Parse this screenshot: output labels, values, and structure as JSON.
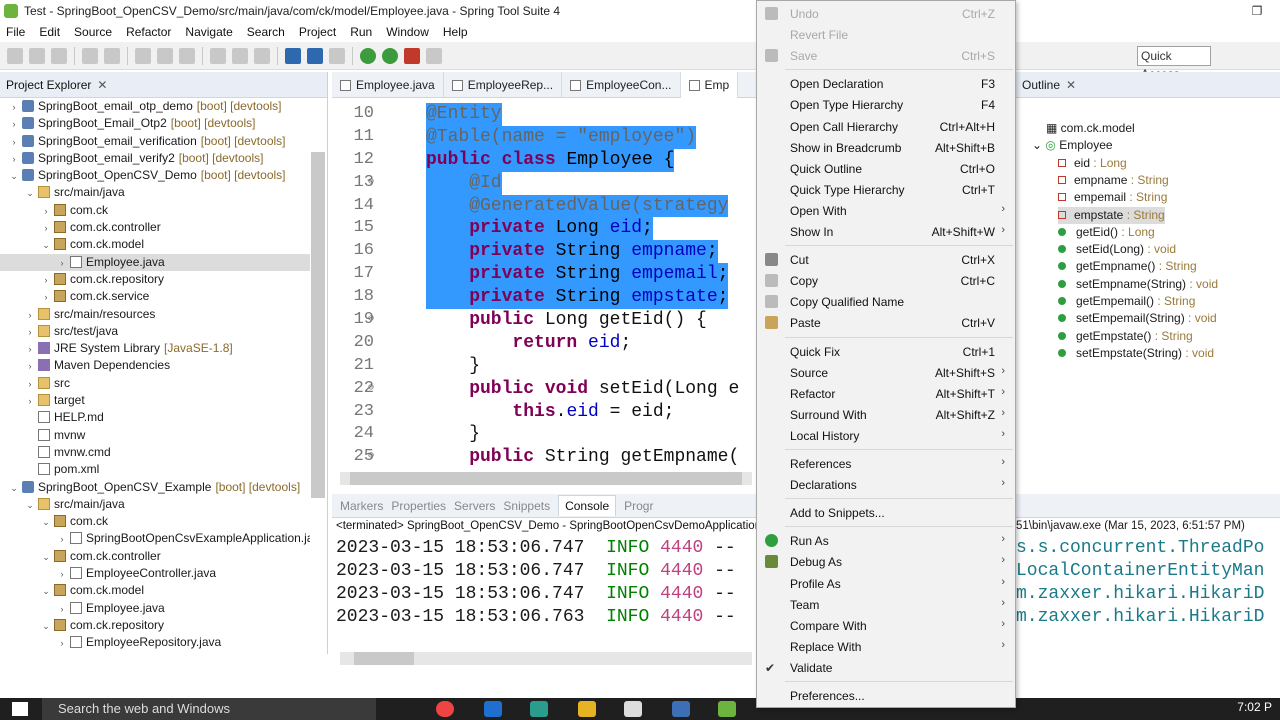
{
  "window": {
    "title": "Test - SpringBoot_OpenCSV_Demo/src/main/java/com/ck/model/Employee.java - Spring Tool Suite 4"
  },
  "menubar": [
    "File",
    "Edit",
    "Source",
    "Refactor",
    "Navigate",
    "Search",
    "Project",
    "Run",
    "Window",
    "Help"
  ],
  "toolbar": {
    "quick_access": "Quick Access"
  },
  "project_explorer": {
    "title": "Project Explorer",
    "items": [
      {
        "arrow": "›",
        "icon": "proj",
        "label": "SpringBoot_email_otp_demo",
        "dec": "[boot] [devtools]",
        "indent": 0
      },
      {
        "arrow": "›",
        "icon": "proj",
        "label": "SpringBoot_Email_Otp2",
        "dec": "[boot] [devtools]",
        "indent": 0
      },
      {
        "arrow": "›",
        "icon": "proj",
        "label": "SpringBoot_email_verification",
        "dec": "[boot] [devtools]",
        "indent": 0
      },
      {
        "arrow": "›",
        "icon": "proj",
        "label": "SpringBoot_email_verify2",
        "dec": "[boot] [devtools]",
        "indent": 0
      },
      {
        "arrow": "⌄",
        "icon": "proj",
        "label": "SpringBoot_OpenCSV_Demo",
        "dec": "[boot] [devtools]",
        "indent": 0
      },
      {
        "arrow": "⌄",
        "icon": "fold",
        "label": "src/main/java",
        "dec": "",
        "indent": 1
      },
      {
        "arrow": "›",
        "icon": "pkg",
        "label": "com.ck",
        "dec": "",
        "indent": 2
      },
      {
        "arrow": "›",
        "icon": "pkg",
        "label": "com.ck.controller",
        "dec": "",
        "indent": 2
      },
      {
        "arrow": "⌄",
        "icon": "pkg",
        "label": "com.ck.model",
        "dec": "",
        "indent": 2
      },
      {
        "arrow": "›",
        "icon": "file",
        "label": "Employee.java",
        "dec": "",
        "indent": 3,
        "selected": true
      },
      {
        "arrow": "›",
        "icon": "pkg",
        "label": "com.ck.repository",
        "dec": "",
        "indent": 2
      },
      {
        "arrow": "›",
        "icon": "pkg",
        "label": "com.ck.service",
        "dec": "",
        "indent": 2
      },
      {
        "arrow": "›",
        "icon": "fold",
        "label": "src/main/resources",
        "dec": "",
        "indent": 1
      },
      {
        "arrow": "›",
        "icon": "fold",
        "label": "src/test/java",
        "dec": "",
        "indent": 1
      },
      {
        "arrow": "›",
        "icon": "lib",
        "label": "JRE System Library",
        "dec": "[JavaSE-1.8]",
        "indent": 1
      },
      {
        "arrow": "›",
        "icon": "lib",
        "label": "Maven Dependencies",
        "dec": "",
        "indent": 1
      },
      {
        "arrow": "›",
        "icon": "fold",
        "label": "src",
        "dec": "",
        "indent": 1
      },
      {
        "arrow": "›",
        "icon": "fold",
        "label": "target",
        "dec": "",
        "indent": 1
      },
      {
        "arrow": "",
        "icon": "file",
        "label": "HELP.md",
        "dec": "",
        "indent": 1
      },
      {
        "arrow": "",
        "icon": "file",
        "label": "mvnw",
        "dec": "",
        "indent": 1
      },
      {
        "arrow": "",
        "icon": "file",
        "label": "mvnw.cmd",
        "dec": "",
        "indent": 1
      },
      {
        "arrow": "",
        "icon": "file",
        "label": "pom.xml",
        "dec": "",
        "indent": 1
      },
      {
        "arrow": "⌄",
        "icon": "proj",
        "label": "SpringBoot_OpenCSV_Example",
        "dec": "[boot] [devtools]",
        "indent": 0
      },
      {
        "arrow": "⌄",
        "icon": "fold",
        "label": "src/main/java",
        "dec": "",
        "indent": 1
      },
      {
        "arrow": "⌄",
        "icon": "pkg",
        "label": "com.ck",
        "dec": "",
        "indent": 2
      },
      {
        "arrow": "›",
        "icon": "file",
        "label": "SpringBootOpenCsvExampleApplication.jav",
        "dec": "",
        "indent": 3
      },
      {
        "arrow": "⌄",
        "icon": "pkg",
        "label": "com.ck.controller",
        "dec": "",
        "indent": 2
      },
      {
        "arrow": "›",
        "icon": "file",
        "label": "EmployeeController.java",
        "dec": "",
        "indent": 3
      },
      {
        "arrow": "⌄",
        "icon": "pkg",
        "label": "com.ck.model",
        "dec": "",
        "indent": 2
      },
      {
        "arrow": "›",
        "icon": "file",
        "label": "Employee.java",
        "dec": "",
        "indent": 3
      },
      {
        "arrow": "⌄",
        "icon": "pkg",
        "label": "com.ck.repository",
        "dec": "",
        "indent": 2
      },
      {
        "arrow": "›",
        "icon": "file",
        "label": "EmployeeRepository.java",
        "dec": "",
        "indent": 3
      }
    ]
  },
  "editor": {
    "tabs": [
      "Employee.java",
      "EmployeeRep...",
      "EmployeeCon...",
      "Emp"
    ],
    "lines": [
      {
        "n": "10",
        "hl": true,
        "fold": false,
        "parts": [
          {
            "c": "ann",
            "t": "@Entity"
          }
        ]
      },
      {
        "n": "11",
        "hl": true,
        "fold": false,
        "parts": [
          {
            "c": "ann",
            "t": "@Table(name = \"employee\")"
          }
        ]
      },
      {
        "n": "12",
        "hl": true,
        "fold": false,
        "parts": [
          {
            "c": "kw",
            "t": "public class "
          },
          {
            "c": "",
            "t": "Employee {"
          }
        ]
      },
      {
        "n": "13",
        "hl": true,
        "fold": true,
        "parts": [
          {
            "c": "ann",
            "t": "    @Id"
          }
        ]
      },
      {
        "n": "14",
        "hl": true,
        "fold": false,
        "parts": [
          {
            "c": "ann",
            "t": "    @GeneratedValue(strategy"
          }
        ]
      },
      {
        "n": "15",
        "hl": true,
        "fold": false,
        "parts": [
          {
            "c": "kw",
            "t": "    private "
          },
          {
            "c": "",
            "t": "Long "
          },
          {
            "c": "fld",
            "t": "eid"
          },
          {
            "c": "",
            "t": ";"
          }
        ]
      },
      {
        "n": "16",
        "hl": true,
        "fold": false,
        "parts": [
          {
            "c": "kw",
            "t": "    private "
          },
          {
            "c": "",
            "t": "String "
          },
          {
            "c": "fld",
            "t": "empname"
          },
          {
            "c": "",
            "t": ";"
          }
        ]
      },
      {
        "n": "17",
        "hl": true,
        "fold": false,
        "parts": [
          {
            "c": "kw",
            "t": "    private "
          },
          {
            "c": "",
            "t": "String "
          },
          {
            "c": "fld",
            "t": "empemail"
          },
          {
            "c": "",
            "t": ";"
          }
        ]
      },
      {
        "n": "18",
        "hl": true,
        "fold": false,
        "parts": [
          {
            "c": "kw",
            "t": "    private "
          },
          {
            "c": "",
            "t": "String "
          },
          {
            "c": "fld",
            "t": "empstate"
          },
          {
            "c": "",
            "t": ";"
          }
        ]
      },
      {
        "n": "19",
        "hl": false,
        "fold": true,
        "parts": [
          {
            "c": "kw",
            "t": "    public "
          },
          {
            "c": "",
            "t": "Long getEid() {"
          }
        ]
      },
      {
        "n": "20",
        "hl": false,
        "fold": false,
        "parts": [
          {
            "c": "kw",
            "t": "        return "
          },
          {
            "c": "fld",
            "t": "eid"
          },
          {
            "c": "",
            "t": ";"
          }
        ]
      },
      {
        "n": "21",
        "hl": false,
        "fold": false,
        "parts": [
          {
            "c": "",
            "t": "    }"
          }
        ]
      },
      {
        "n": "22",
        "hl": false,
        "fold": true,
        "parts": [
          {
            "c": "kw",
            "t": "    public void "
          },
          {
            "c": "",
            "t": "setEid(Long e"
          }
        ]
      },
      {
        "n": "23",
        "hl": false,
        "fold": false,
        "parts": [
          {
            "c": "kw",
            "t": "        this"
          },
          {
            "c": "",
            "t": "."
          },
          {
            "c": "fld",
            "t": "eid"
          },
          {
            "c": "",
            "t": " = eid;"
          }
        ]
      },
      {
        "n": "24",
        "hl": false,
        "fold": false,
        "parts": [
          {
            "c": "",
            "t": "    }"
          }
        ]
      },
      {
        "n": "25",
        "hl": false,
        "fold": true,
        "parts": [
          {
            "c": "kw",
            "t": "    public "
          },
          {
            "c": "",
            "t": "String getEmpname("
          }
        ]
      }
    ]
  },
  "console": {
    "tabs": [
      "Markers",
      "Properties",
      "Servers",
      "Snippets",
      "Console",
      "Progr"
    ],
    "active_tab": "Console",
    "terminated": "<terminated> SpringBoot_OpenCSV_Demo - SpringBootOpenCsvDemoApplication",
    "terminated_right": "51\\bin\\javaw.exe (Mar 15, 2023, 6:51:57 PM)",
    "lines": [
      {
        "ts": "2023-03-15 18:53:06.747",
        "lvl": "INFO",
        "pid": "4440",
        "rest": " --",
        "right": "s.s.concurrent.ThreadPo"
      },
      {
        "ts": "2023-03-15 18:53:06.747",
        "lvl": "INFO",
        "pid": "4440",
        "rest": " --",
        "right": "LocalContainerEntityMan"
      },
      {
        "ts": "2023-03-15 18:53:06.747",
        "lvl": "INFO",
        "pid": "4440",
        "rest": " --",
        "right": "m.zaxxer.hikari.HikariD"
      },
      {
        "ts": "2023-03-15 18:53:06.763",
        "lvl": "INFO",
        "pid": "4440",
        "rest": " --",
        "right": "m.zaxxer.hikari.HikariD"
      }
    ]
  },
  "outline": {
    "title": "Outline",
    "items": [
      {
        "kind": "pkg",
        "label": "com.ck.model",
        "type": ""
      },
      {
        "kind": "class",
        "label": "Employee",
        "type": ""
      },
      {
        "kind": "field",
        "label": "eid",
        "type": " : Long"
      },
      {
        "kind": "field",
        "label": "empname",
        "type": " : String"
      },
      {
        "kind": "field",
        "label": "empemail",
        "type": " : String"
      },
      {
        "kind": "field",
        "label": "empstate",
        "type": " : String",
        "selected": true
      },
      {
        "kind": "method",
        "label": "getEid()",
        "type": " : Long"
      },
      {
        "kind": "method",
        "label": "setEid(Long)",
        "type": " : void"
      },
      {
        "kind": "method",
        "label": "getEmpname()",
        "type": " : String"
      },
      {
        "kind": "method",
        "label": "setEmpname(String)",
        "type": " : void"
      },
      {
        "kind": "method",
        "label": "getEmpemail()",
        "type": " : String"
      },
      {
        "kind": "method",
        "label": "setEmpemail(String)",
        "type": " : void"
      },
      {
        "kind": "method",
        "label": "getEmpstate()",
        "type": " : String"
      },
      {
        "kind": "method",
        "label": "setEmpstate(String)",
        "type": " : void"
      }
    ]
  },
  "context_menu": {
    "items": [
      {
        "label": "Undo",
        "acc": "Ctrl+Z",
        "disabled": true,
        "icon": "undo"
      },
      {
        "label": "Revert File",
        "acc": "",
        "disabled": true
      },
      {
        "label": "Save",
        "acc": "Ctrl+S",
        "disabled": true,
        "icon": "save"
      },
      {
        "sep": true
      },
      {
        "label": "Open Declaration",
        "acc": "F3"
      },
      {
        "label": "Open Type Hierarchy",
        "acc": "F4"
      },
      {
        "label": "Open Call Hierarchy",
        "acc": "Ctrl+Alt+H"
      },
      {
        "label": "Show in Breadcrumb",
        "acc": "Alt+Shift+B"
      },
      {
        "label": "Quick Outline",
        "acc": "Ctrl+O"
      },
      {
        "label": "Quick Type Hierarchy",
        "acc": "Ctrl+T"
      },
      {
        "label": "Open With",
        "acc": "",
        "sub": true
      },
      {
        "label": "Show In",
        "acc": "Alt+Shift+W",
        "sub": true
      },
      {
        "sep": true
      },
      {
        "label": "Cut",
        "acc": "Ctrl+X",
        "icon": "cut"
      },
      {
        "label": "Copy",
        "acc": "Ctrl+C",
        "icon": "copy"
      },
      {
        "label": "Copy Qualified Name",
        "acc": "",
        "icon": "copyq"
      },
      {
        "label": "Paste",
        "acc": "Ctrl+V",
        "icon": "paste"
      },
      {
        "sep": true
      },
      {
        "label": "Quick Fix",
        "acc": "Ctrl+1"
      },
      {
        "label": "Source",
        "acc": "Alt+Shift+S",
        "sub": true
      },
      {
        "label": "Refactor",
        "acc": "Alt+Shift+T",
        "sub": true
      },
      {
        "label": "Surround With",
        "acc": "Alt+Shift+Z",
        "sub": true
      },
      {
        "label": "Local History",
        "acc": "",
        "sub": true
      },
      {
        "sep": true
      },
      {
        "label": "References",
        "acc": "",
        "sub": true
      },
      {
        "label": "Declarations",
        "acc": "",
        "sub": true
      },
      {
        "sep": true
      },
      {
        "label": "Add to Snippets...",
        "acc": ""
      },
      {
        "sep": true
      },
      {
        "label": "Run As",
        "acc": "",
        "sub": true,
        "icon": "run"
      },
      {
        "label": "Debug As",
        "acc": "",
        "sub": true,
        "icon": "debug"
      },
      {
        "label": "Profile As",
        "acc": "",
        "sub": true
      },
      {
        "label": "Team",
        "acc": "",
        "sub": true
      },
      {
        "label": "Compare With",
        "acc": "",
        "sub": true
      },
      {
        "label": "Replace With",
        "acc": "",
        "sub": true
      },
      {
        "label": "Validate",
        "acc": "",
        "icon": "check"
      },
      {
        "sep": true
      },
      {
        "label": "Preferences...",
        "acc": ""
      }
    ]
  },
  "taskbar": {
    "search_placeholder": "Search the web and Windows",
    "clock": "7:02 P"
  }
}
